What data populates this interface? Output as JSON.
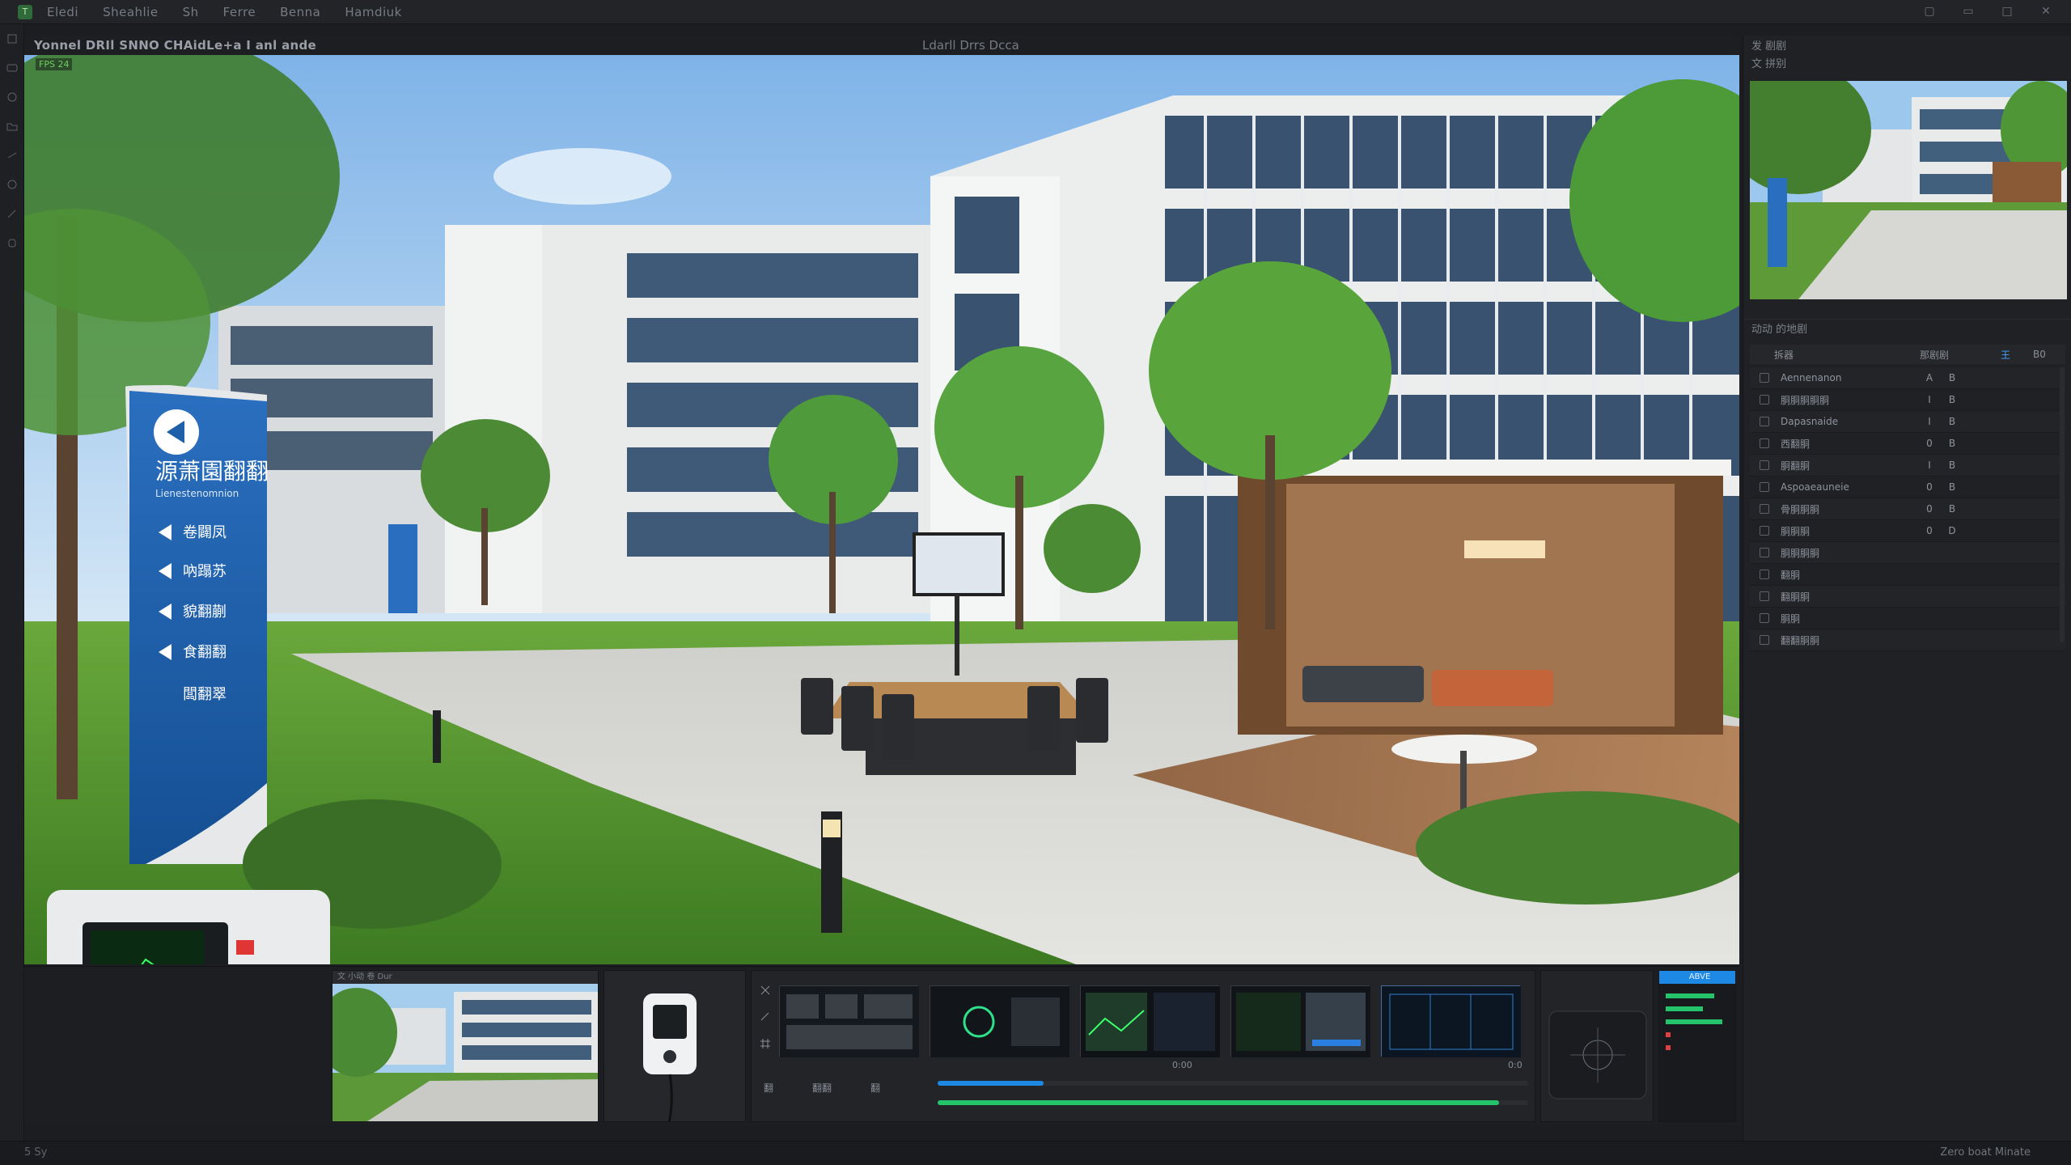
{
  "app": {
    "title_logo_text": "T",
    "menus": [
      "Eledi",
      "Sheahlie",
      "Sh",
      "Ferre",
      "Benna",
      "Hamdiuk"
    ]
  },
  "viewport": {
    "header_left": "Yonnel  DRIl  SNNO  CHAidLe+a I  anl  ande",
    "header_center": "Ldarll  Drrs  Dcca",
    "badge": "FPS 24"
  },
  "sign": {
    "title": "源萧園翻翻",
    "subtitle": "Lienestenomnion",
    "entries": [
      "卷闢凤",
      "吶蹋苏",
      "貌翻蒯",
      "食翻翻",
      "闆翻翠"
    ]
  },
  "right_panel": {
    "title": "发  剧剧",
    "subtitle": "文 拼别",
    "outliner_title": "动动  的地剧",
    "columns": {
      "name": "拆器",
      "type": "那剧剧",
      "flag": "王",
      "misc": "B0"
    },
    "rows": [
      {
        "name": "Aennenanon",
        "v1": "A",
        "v2": "B"
      },
      {
        "name": "胴胴胴胴胴",
        "v1": "I",
        "v2": "B"
      },
      {
        "name": "Dapasnaide",
        "v1": "I",
        "v2": "B"
      },
      {
        "name": "西翻胴",
        "v1": "0",
        "v2": "B"
      },
      {
        "name": "胴翻胴",
        "v1": "I",
        "v2": "B"
      },
      {
        "name": "Aspoaeauneie",
        "v1": "0",
        "v2": "B"
      },
      {
        "name": "骨胴胴胴",
        "v1": "0",
        "v2": "B"
      },
      {
        "name": "胴胴胴",
        "v1": "0",
        "v2": "D"
      },
      {
        "name": "胴胴胴胴",
        "v1": "",
        "v2": ""
      },
      {
        "name": "翻胴",
        "v1": "",
        "v2": ""
      },
      {
        "name": "翻胴胴",
        "v1": "",
        "v2": ""
      },
      {
        "name": "胴胴",
        "v1": "",
        "v2": ""
      },
      {
        "name": "翻翻胴胴",
        "v1": "",
        "v2": ""
      }
    ]
  },
  "bottom": {
    "panel1_title": "文  小动  卷 Dur",
    "panel2_title": "ABVE",
    "timeline_label": "0:00",
    "timeline_end": "0:0",
    "buttons": [
      "翻",
      "翻翻",
      "翻"
    ],
    "progress": [
      0.18,
      0.95
    ]
  },
  "status": {
    "right": "Zero boat Minate",
    "left": "5 Sy"
  },
  "colors": {
    "accent": "#2f8cff",
    "progress_blue": "#1e88e5",
    "progress_green": "#23c46a",
    "sign_blue": "#1e5faa"
  }
}
